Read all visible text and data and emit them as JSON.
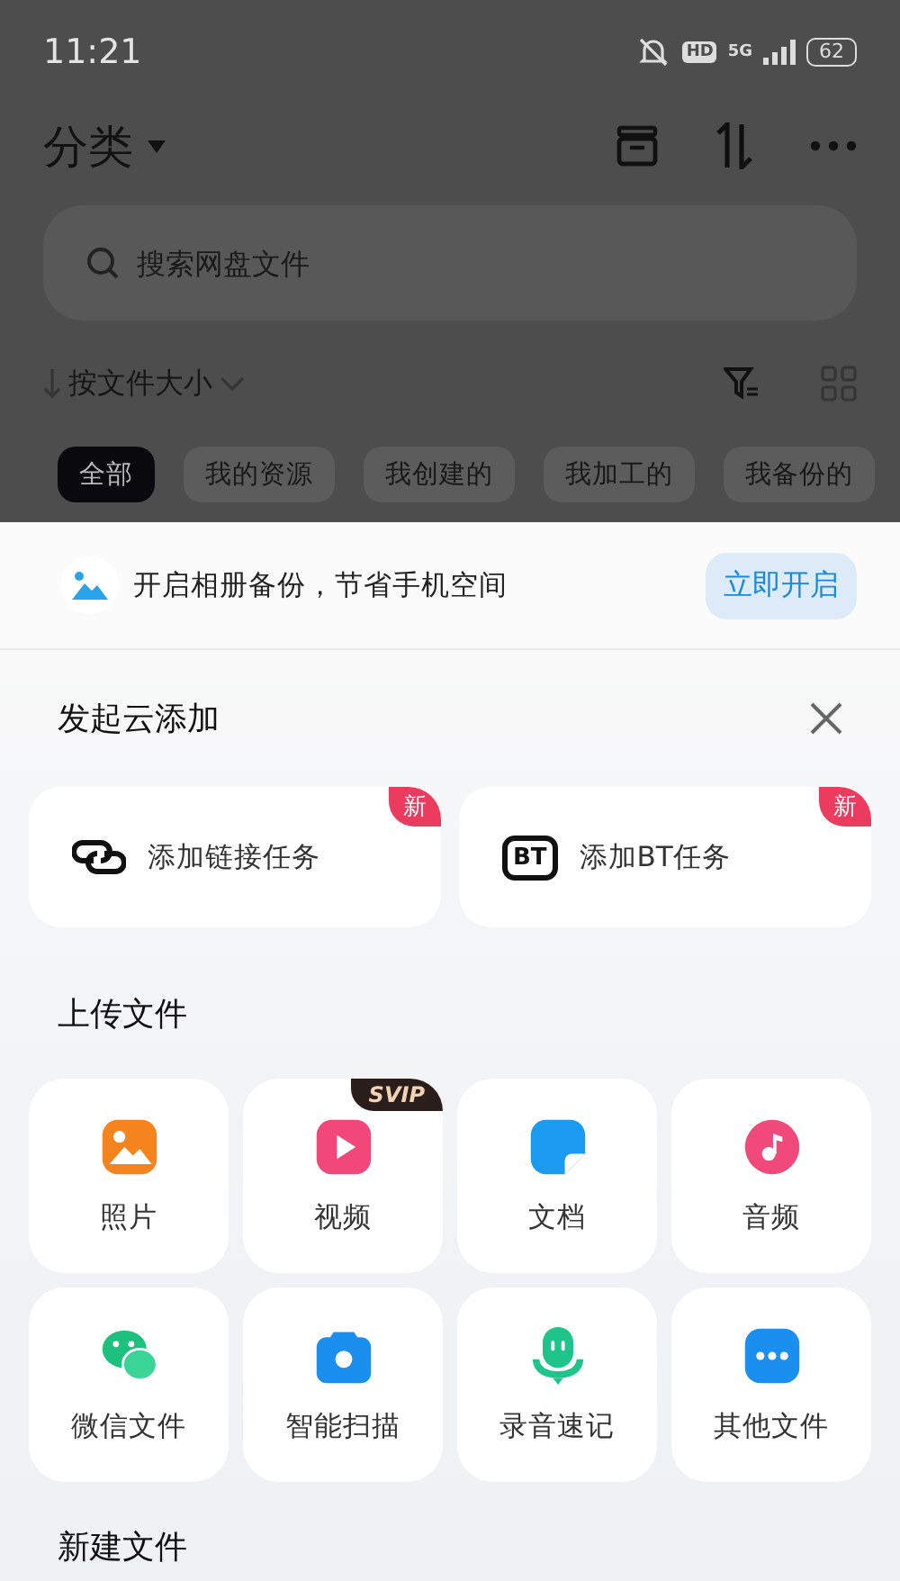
{
  "status_bar": {
    "time": "11:21",
    "hd": "HD",
    "network": "5G",
    "battery": "62"
  },
  "header": {
    "title": "分类"
  },
  "search": {
    "placeholder": "搜索网盘文件"
  },
  "sort": {
    "label": "按文件大小"
  },
  "chips": [
    {
      "label": "全部",
      "selected": true
    },
    {
      "label": "我的资源",
      "selected": false
    },
    {
      "label": "我创建的",
      "selected": false
    },
    {
      "label": "我加工的",
      "selected": false
    },
    {
      "label": "我备份的",
      "selected": false
    }
  ],
  "backup_banner": {
    "text": "开启相册备份，节省手机空间",
    "button": "立即开启"
  },
  "cloud_add": {
    "title": "发起云添加",
    "items": [
      {
        "kind": "link",
        "label": "添加链接任务",
        "badge": "新"
      },
      {
        "kind": "bt",
        "label": "添加BT任务",
        "badge": "新",
        "icon_text": "BT"
      }
    ]
  },
  "upload": {
    "title": "上传文件",
    "items": [
      {
        "kind": "photo",
        "label": "照片"
      },
      {
        "kind": "video",
        "label": "视频",
        "badge": "SVIP"
      },
      {
        "kind": "doc",
        "label": "文档"
      },
      {
        "kind": "audio",
        "label": "音频"
      },
      {
        "kind": "wechat",
        "label": "微信文件"
      },
      {
        "kind": "scan",
        "label": "智能扫描"
      },
      {
        "kind": "record",
        "label": "录音速记"
      },
      {
        "kind": "more",
        "label": "其他文件"
      }
    ]
  },
  "new_file": {
    "title": "新建文件"
  }
}
